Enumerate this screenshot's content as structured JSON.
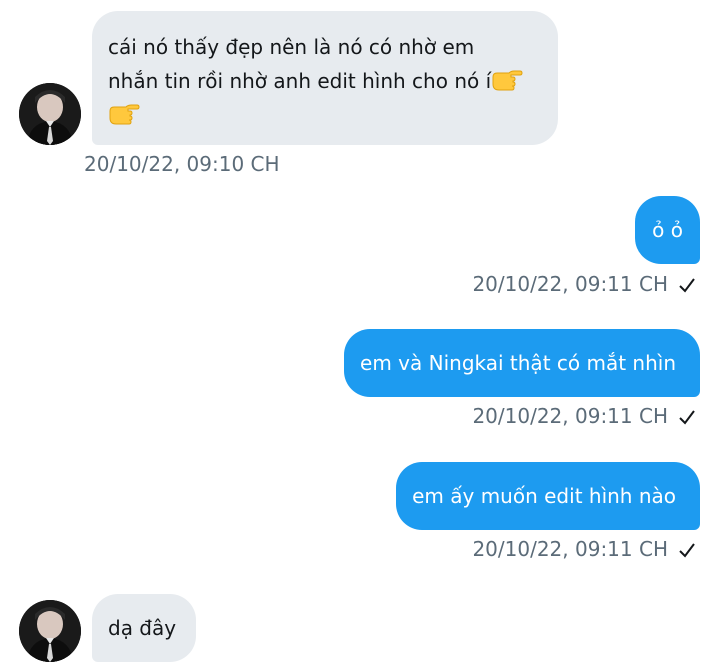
{
  "colors": {
    "incoming_bubble": "#e7ebef",
    "outgoing_bubble": "#1d9bf0",
    "timestamp_text": "#5b6b78"
  },
  "messages": [
    {
      "direction": "incoming",
      "lines": [
        "cái nó thấy đẹp nên là nó có nhờ em",
        "nhắn tin rồi nhờ anh edit hình cho nó í"
      ],
      "emojis": [
        "backhand-index-pointing-right",
        "backhand-index-pointing-right"
      ],
      "timestamp": "20/10/22,  09:10 CH",
      "avatar": "avatar-icon"
    },
    {
      "direction": "outgoing",
      "text": "ỏ ỏ",
      "timestamp": "20/10/22,  09:11 CH",
      "status_icon": "checkmark-icon"
    },
    {
      "direction": "outgoing",
      "text": "em và Ningkai thật có mắt nhìn",
      "timestamp": "20/10/22,  09:11 CH",
      "status_icon": "checkmark-icon"
    },
    {
      "direction": "outgoing",
      "text": "em ấy muốn edit hình nào",
      "timestamp": "20/10/22,  09:11 CH",
      "status_icon": "checkmark-icon"
    },
    {
      "direction": "incoming",
      "text": "dạ đây",
      "avatar": "avatar-icon"
    }
  ]
}
